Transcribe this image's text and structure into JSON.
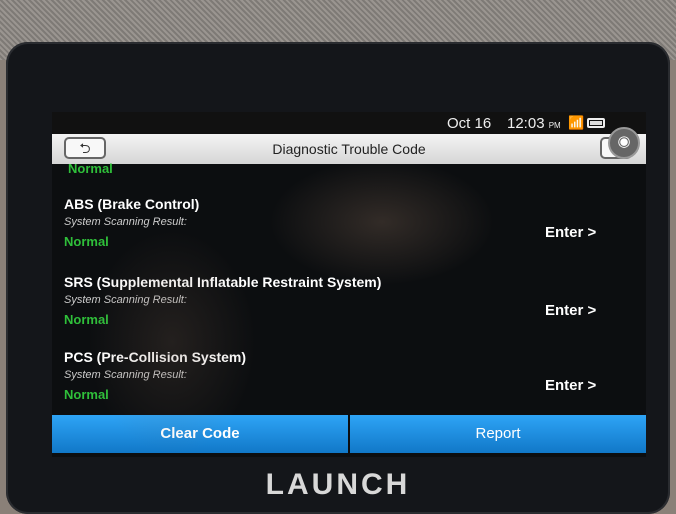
{
  "status_bar": {
    "date": "Oct 16",
    "time": "12:03",
    "ampm": "PM"
  },
  "title_bar": {
    "title": "Diagnostic Trouble Code",
    "back_glyph": "⮌",
    "exit_glyph": "⇥"
  },
  "partial_status": "Normal",
  "systems": [
    {
      "name": "ABS (Brake Control)",
      "sub": "System Scanning Result:",
      "status": "Normal",
      "enter": "Enter >"
    },
    {
      "name": "SRS (Supplemental Inflatable Restraint System)",
      "sub": "System Scanning Result:",
      "status": "Normal",
      "enter": "Enter >"
    },
    {
      "name": "PCS (Pre-Collision System)",
      "sub": "System Scanning Result:",
      "status": "Normal",
      "enter": "Enter >"
    }
  ],
  "buttons": {
    "clear": "Clear Code",
    "report": "Report"
  },
  "brand": "LAUNCH",
  "colors": {
    "accent": "#1e8fe0",
    "normal": "#2fbf3a"
  },
  "icons": {
    "camera": "camera-icon",
    "wifi": "wifi-icon",
    "battery": "battery-icon"
  }
}
